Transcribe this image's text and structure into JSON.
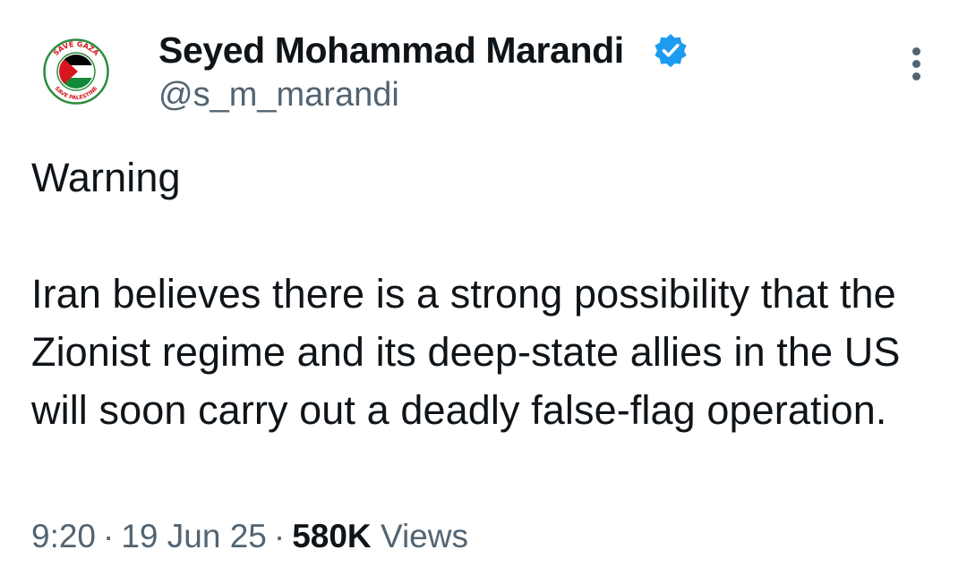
{
  "author": {
    "display_name": "Seyed Mohammad Marandi",
    "handle": "@s_m_marandi",
    "verified": true,
    "verified_icon": "verified-badge-icon",
    "verified_color": "#1d9bf0",
    "avatar_badge_text_top": "SAVE GAZA",
    "avatar_badge_text_bottom": "SAVE PALESTINE"
  },
  "tweet": {
    "line_1": "Warning",
    "paragraph_2": "Iran believes there is a strong possibility that the Zionist regime and its deep-state allies in the US will soon carry out a deadly false-flag operation."
  },
  "meta": {
    "time": "9:20",
    "date": "19 Jun 25",
    "separator": "·",
    "views_count": "580K",
    "views_label": "Views"
  },
  "colors": {
    "text_primary": "#0f1419",
    "text_secondary": "#536471",
    "flag_red": "#d7161e",
    "flag_green": "#138a3a",
    "flag_black": "#000000",
    "badge_ring": "#2e8b3d"
  },
  "icons": {
    "more": "more-options-icon"
  }
}
